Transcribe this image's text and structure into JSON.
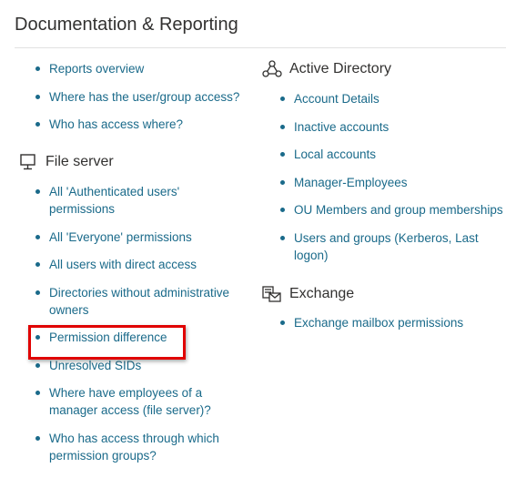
{
  "page": {
    "title": "Documentation & Reporting"
  },
  "reports": {
    "items": [
      {
        "label": "Reports overview"
      },
      {
        "label": "Where has the user/group access?"
      },
      {
        "label": "Who has access where?"
      }
    ]
  },
  "file_server": {
    "title": "File server",
    "icon": "file-server-icon",
    "items": [
      {
        "label": "All 'Authenticated users' permissions"
      },
      {
        "label": "All 'Everyone' permissions"
      },
      {
        "label": "All users with direct access"
      },
      {
        "label": "Directories without administrative owners"
      },
      {
        "label": "Permission difference"
      },
      {
        "label": "Unresolved SIDs"
      },
      {
        "label": "Where have employees of a manager access (file server)?"
      },
      {
        "label": "Who has access through which permission groups?"
      }
    ]
  },
  "active_directory": {
    "title": "Active Directory",
    "icon": "active-directory-icon",
    "items": [
      {
        "label": "Account Details"
      },
      {
        "label": "Inactive accounts"
      },
      {
        "label": "Local accounts"
      },
      {
        "label": "Manager-Employees"
      },
      {
        "label": "OU Members and group memberships"
      },
      {
        "label": "Users and groups (Kerberos, Last logon)"
      }
    ]
  },
  "exchange": {
    "title": "Exchange",
    "icon": "exchange-icon",
    "items": [
      {
        "label": "Exchange mailbox permissions"
      }
    ]
  },
  "colors": {
    "link": "#1a6a8a",
    "heading": "#323130",
    "highlight": "#e00000"
  }
}
